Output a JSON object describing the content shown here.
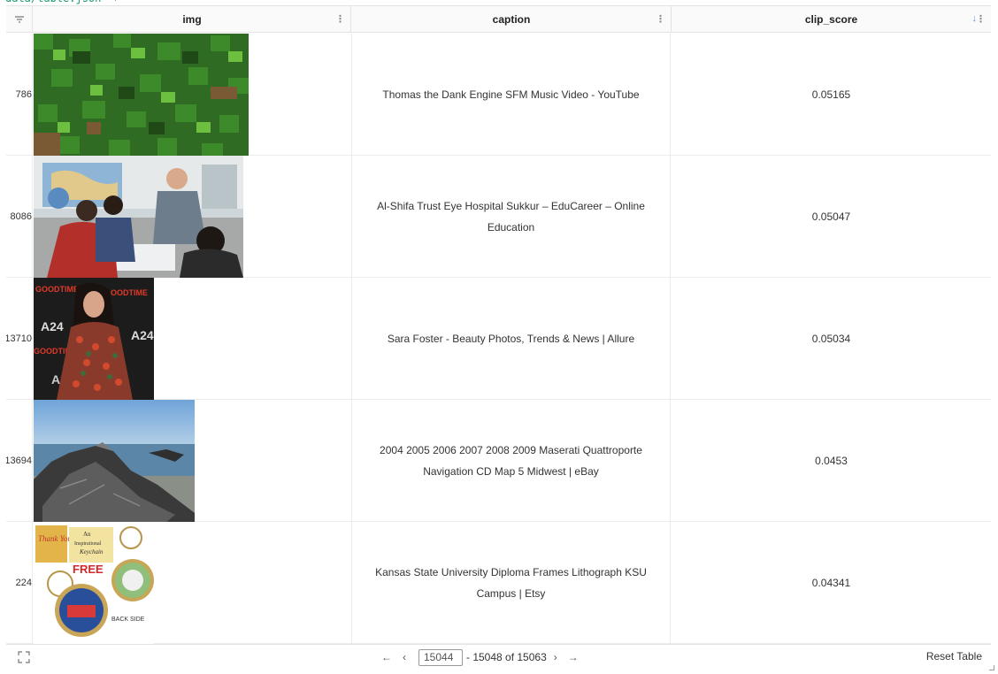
{
  "header": {
    "columns": [
      {
        "label": "img"
      },
      {
        "label": "caption"
      },
      {
        "label": "clip_score"
      }
    ]
  },
  "rows": [
    {
      "index": "786",
      "image": "minecraft grass block texture",
      "caption": "Thomas the Dank Engine SFM Music Video - YouTube",
      "clip_score": "0.05165"
    },
    {
      "index": "8086",
      "image": "classroom with teacher and students",
      "caption": "Al-Shifa Trust Eye Hospital Sukkur – EduCareer – Online Education",
      "clip_score": "0.05047"
    },
    {
      "index": "13710",
      "image": "woman in patterned dress at event",
      "caption": "Sara Foster - Beauty Photos, Trends & News | Allure",
      "clip_score": "0.05034"
    },
    {
      "index": "13694",
      "image": "rocky seashore",
      "caption": "2004 2005 2006 2007 2008 2009 Maserati Quattroporte Navigation CD Map 5 Midwest | eBay",
      "clip_score": "0.0453"
    },
    {
      "index": "224",
      "image": "keychain thank you product",
      "caption": "Kansas State University Diploma Frames Lithograph KSU Campus | Etsy",
      "clip_score": "0.04341"
    }
  ],
  "pagination": {
    "current": "15044",
    "range_suffix": "- 15048 of 15063",
    "prev_first": "←",
    "prev": "‹",
    "next": "›",
    "next_last": "→"
  },
  "footer": {
    "reset_label": "Reset Table"
  },
  "keychain_text": {
    "thank": "Thank You",
    "free": "FREE",
    "back_side": "BACK SIDE",
    "card_line1": "An",
    "card_line2": "Inspirational",
    "card_line3": "Keychain"
  },
  "photo_text": {
    "goodtime": "GOODTIME",
    "a24": "A24"
  },
  "colors": {
    "accent": "#6a8fd8",
    "border": "#e3e3e3"
  }
}
